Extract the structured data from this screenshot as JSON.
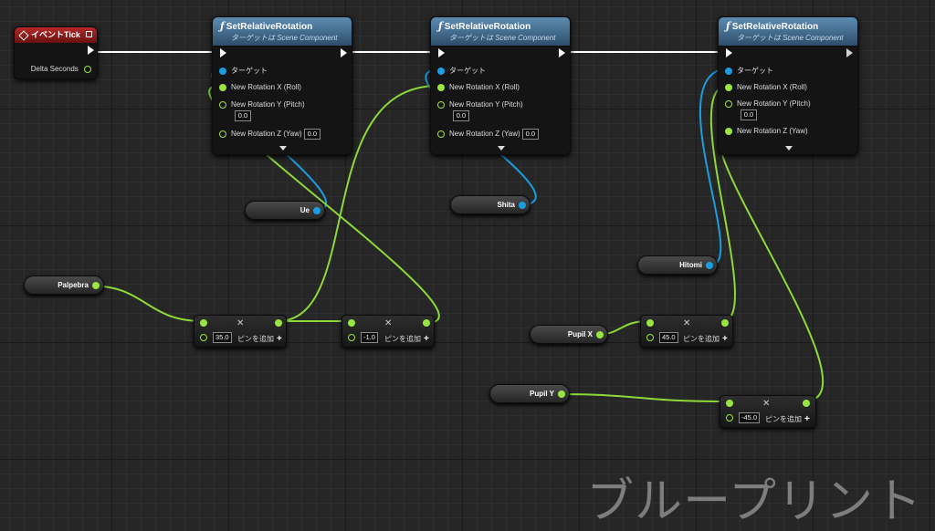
{
  "event_node": {
    "title": "イベントTick",
    "pin_delta": "Delta Seconds"
  },
  "function_nodes": [
    {
      "title": "SetRelativeRotation",
      "subtitle": "ターゲットは Scene Component",
      "pin_target": "ターゲット",
      "pin_x": "New Rotation X (Roll)",
      "pin_y": "New Rotation Y (Pitch)",
      "pin_y_value": "0.0",
      "pin_z": "New Rotation Z (Yaw)",
      "pin_z_value": "0.0"
    },
    {
      "title": "SetRelativeRotation",
      "subtitle": "ターゲットは Scene Component",
      "pin_target": "ターゲット",
      "pin_x": "New Rotation X (Roll)",
      "pin_y": "New Rotation Y (Pitch)",
      "pin_y_value": "0.0",
      "pin_z": "New Rotation Z (Yaw)",
      "pin_z_value": "0.0"
    },
    {
      "title": "SetRelativeRotation",
      "subtitle": "ターゲットは Scene Component",
      "pin_target": "ターゲット",
      "pin_x": "New Rotation X (Roll)",
      "pin_y": "New Rotation Y (Pitch)",
      "pin_y_value": "0.0",
      "pin_z": "New Rotation Z (Yaw)"
    }
  ],
  "variables": {
    "ue": "Ue",
    "shita": "Shita",
    "hitomi": "Hitomi",
    "palpebra": "Palpebra",
    "pupil_x": "Pupil X",
    "pupil_y": "Pupil Y"
  },
  "math_nodes": [
    {
      "value": "35.0",
      "add_pin": "ピンを追加"
    },
    {
      "value": "-1.0",
      "add_pin": "ピンを追加"
    },
    {
      "value": "45.0",
      "add_pin": "ピンを追加"
    },
    {
      "value": "-45.0",
      "add_pin": "ピンを追加"
    }
  ],
  "watermark": "ブループリント",
  "colors": {
    "exec": "#ffffff",
    "object_pin": "#1b9ee0",
    "float_pin": "#9ae640",
    "event_header": "#b52828",
    "function_header": "#5c8cb2"
  },
  "icons": {
    "function": "f-function-icon",
    "event": "diamond-event-icon",
    "add_pin": "plus-icon",
    "remove": "x-icon"
  }
}
